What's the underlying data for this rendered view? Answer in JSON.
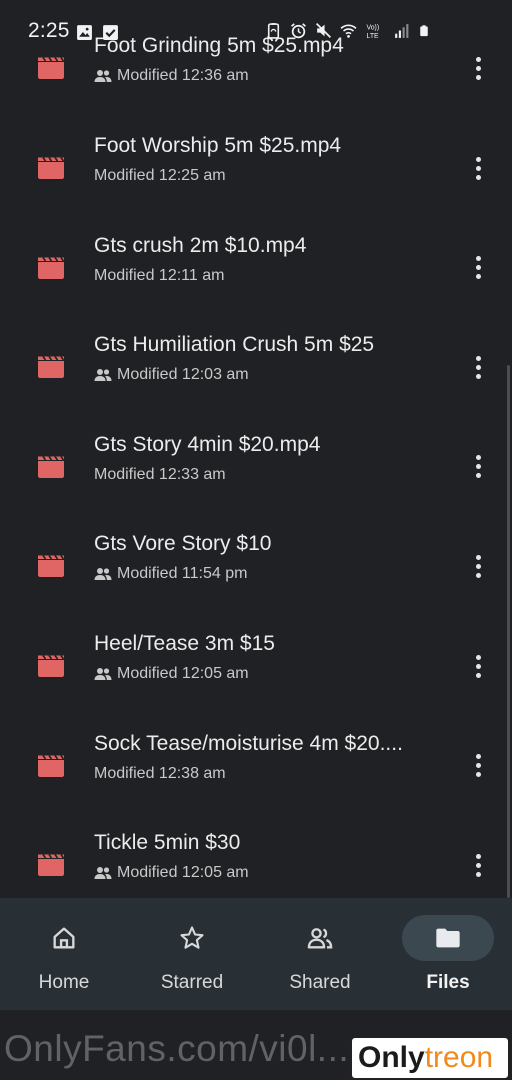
{
  "status": {
    "time": "2:25",
    "volte_label": "Vo)) LTE"
  },
  "files": [
    {
      "name": "Foot Grinding 5m $25.mp4",
      "modified": "Modified 12:36 am",
      "shared": true
    },
    {
      "name": "Foot Worship 5m $25.mp4",
      "modified": "Modified 12:25 am",
      "shared": false
    },
    {
      "name": "Gts crush 2m $10.mp4",
      "modified": "Modified 12:11 am",
      "shared": false
    },
    {
      "name": "Gts Humiliation Crush 5m $25",
      "modified": "Modified 12:03 am",
      "shared": true
    },
    {
      "name": "Gts Story 4min $20.mp4",
      "modified": "Modified 12:33 am",
      "shared": false
    },
    {
      "name": "Gts Vore Story $10",
      "modified": "Modified 11:54 pm",
      "shared": true
    },
    {
      "name": "Heel/Tease 3m $15",
      "modified": "Modified 12:05 am",
      "shared": true
    },
    {
      "name": "Sock Tease/moisturise 4m $20....",
      "modified": "Modified 12:38 am",
      "shared": false
    },
    {
      "name": "Tickle 5min $30",
      "modified": "Modified 12:05 am",
      "shared": true
    }
  ],
  "nav": {
    "items": [
      {
        "label": "Home",
        "icon": "home-icon",
        "active": false
      },
      {
        "label": "Starred",
        "icon": "star-icon",
        "active": false
      },
      {
        "label": "Shared",
        "icon": "people-icon",
        "active": false
      },
      {
        "label": "Files",
        "icon": "folder-icon",
        "active": true
      }
    ]
  },
  "colors": {
    "file_icon": "#e06666",
    "background": "#1f2124",
    "nav_background": "#283036",
    "nav_active_pill": "#3c4850"
  },
  "watermark": {
    "text": "OnlyFans.com/vi0l...",
    "logo_part1": "Only",
    "logo_part2": "treon"
  }
}
